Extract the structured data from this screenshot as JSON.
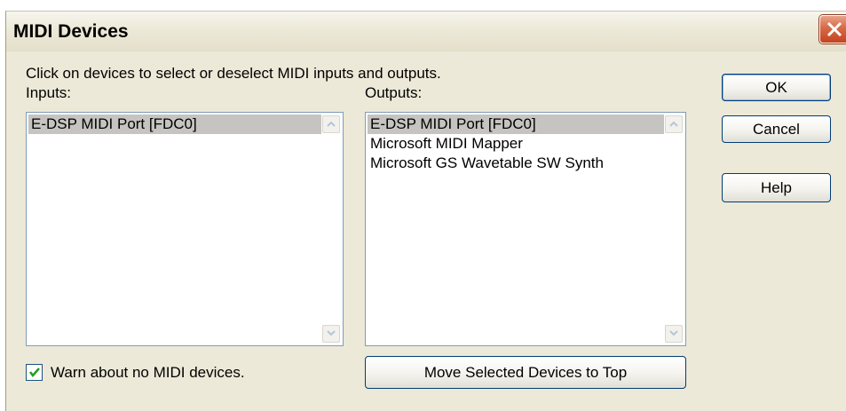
{
  "window": {
    "title": "MIDI Devices"
  },
  "instruction": "Click on devices to select or deselect MIDI inputs and outputs.",
  "inputs": {
    "label": "Inputs:",
    "items": [
      {
        "label": "E-DSP MIDI Port [FDC0]",
        "selected": true
      }
    ]
  },
  "outputs": {
    "label": "Outputs:",
    "items": [
      {
        "label": "E-DSP MIDI Port [FDC0]",
        "selected": true
      },
      {
        "label": "Microsoft MIDI Mapper",
        "selected": false
      },
      {
        "label": "Microsoft GS Wavetable SW Synth",
        "selected": false
      }
    ]
  },
  "buttons": {
    "ok": "OK",
    "cancel": "Cancel",
    "help": "Help",
    "move_to_top": "Move Selected Devices to Top"
  },
  "warn_checkbox": {
    "label": "Warn about no MIDI devices.",
    "checked": true
  },
  "colors": {
    "close_button": "#d76a46",
    "selection": "#c6c4c0",
    "dialog_bg": "#ece9d8"
  },
  "icons": {
    "close": "close-x-icon",
    "scroll_up": "chevron-up-icon",
    "scroll_down": "chevron-down-icon",
    "check": "checkmark-icon"
  }
}
